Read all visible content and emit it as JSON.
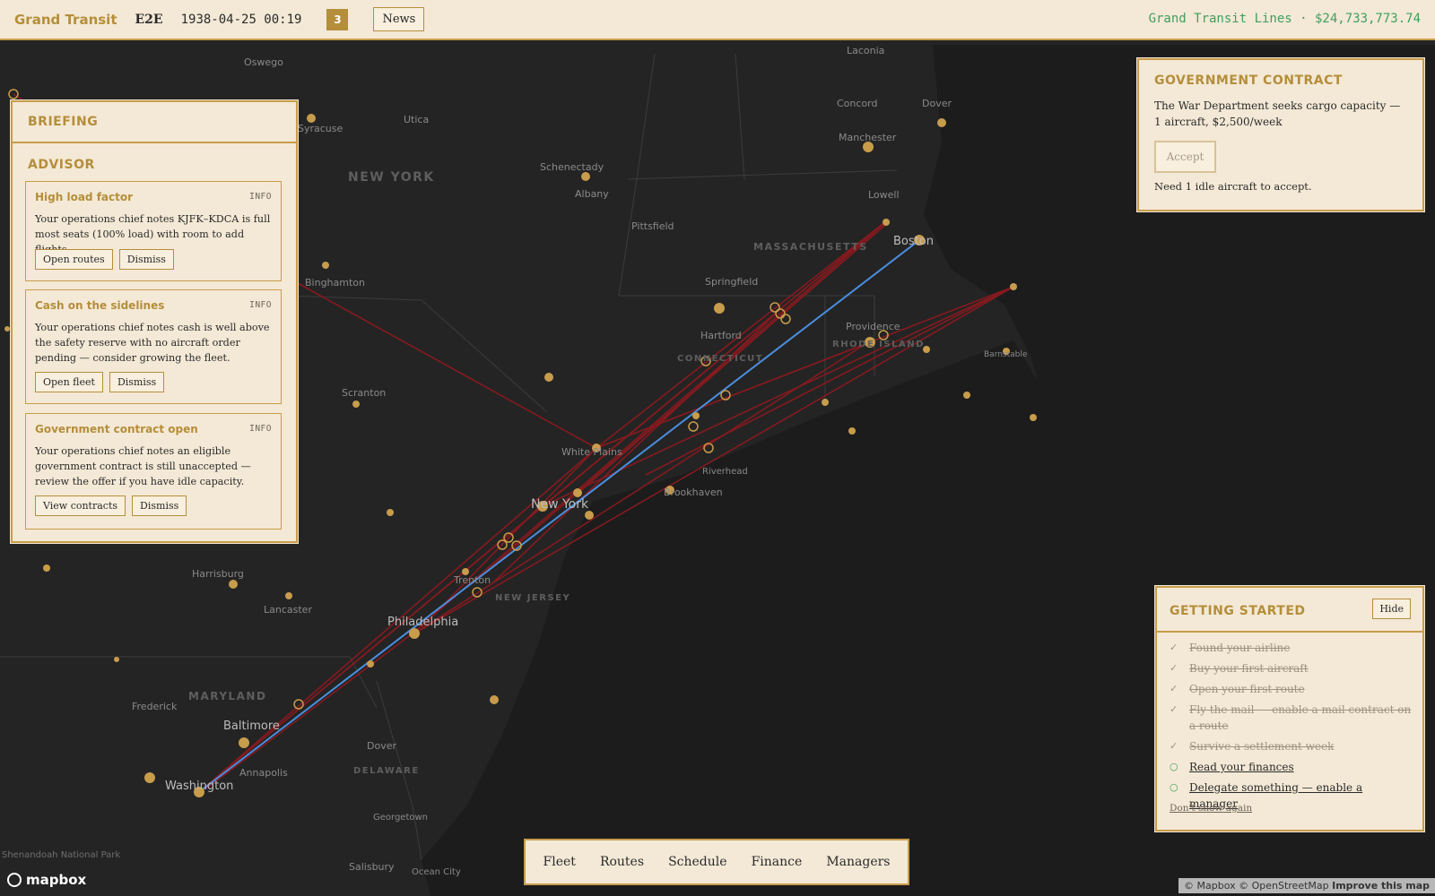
{
  "topbar": {
    "brand": "Grand Transit",
    "code": "E2E",
    "datetime": "1938-04-25 00:19",
    "notifications": "3",
    "news_label": "News",
    "company_cash": "Grand Transit Lines · $24,733,773.74"
  },
  "briefing": {
    "title": "BRIEFING",
    "advisor_title": "ADVISOR",
    "cards": [
      {
        "title": "High load factor",
        "tag": "INFO",
        "body": "Your operations chief notes KJFK–KDCA is full most seats (100% load) with room to add flights.",
        "primary": "Open routes",
        "dismiss": "Dismiss"
      },
      {
        "title": "Cash on the sidelines",
        "tag": "INFO",
        "body": "Your operations chief notes cash is well above the safety reserve with no aircraft order pending — consider growing the fleet.",
        "primary": "Open fleet",
        "dismiss": "Dismiss"
      },
      {
        "title": "Government contract open",
        "tag": "INFO",
        "body": "Your operations chief notes an eligible government contract is still unaccepted — review the offer if you have idle capacity.",
        "primary": "View contracts",
        "dismiss": "Dismiss"
      }
    ]
  },
  "government_contract": {
    "title": "GOVERNMENT CONTRACT",
    "body": "The War Department seeks cargo capacity — 1 aircraft, $2,500/week",
    "accept": "Accept",
    "note": "Need 1 idle aircraft to accept."
  },
  "getting_started": {
    "title": "GETTING STARTED",
    "hide": "Hide",
    "done_mark": "✓",
    "todo_mark": "○",
    "steps": [
      {
        "label": "Found your airline",
        "done": true
      },
      {
        "label": "Buy your first aircraft",
        "done": true
      },
      {
        "label": "Open your first route",
        "done": true
      },
      {
        "label": "Fly the mail — enable a mail contract on a route",
        "done": true
      },
      {
        "label": "Survive a settlement week",
        "done": true
      },
      {
        "label": "Read your finances",
        "done": false
      },
      {
        "label": "Delegate something — enable a manager",
        "done": false
      }
    ],
    "dont_show": "Don't show again"
  },
  "bottom_nav": [
    "Fleet",
    "Routes",
    "Schedule",
    "Finance",
    "Managers"
  ],
  "map": {
    "colors": {
      "route_red": "#8b1a1f",
      "route_blue": "#4a8fe0",
      "city_gold": "#c79c4b",
      "land": "#242424"
    },
    "city_labels": [
      "Oswego",
      "Laconia",
      "Concord",
      "Dover",
      "Manchester",
      "Lowell",
      "Boston",
      "Utica",
      "Syracuse",
      "Schenectady",
      "Albany",
      "Pittsfield",
      "Springfield",
      "Hartford",
      "Providence",
      "Barnstable",
      "Binghamton",
      "Scranton",
      "White Plains",
      "New York",
      "Riverhead",
      "Brookhaven",
      "Trenton",
      "Philadelphia",
      "Harrisburg",
      "Lancaster",
      "Frederick",
      "Baltimore",
      "Annapolis",
      "Washington",
      "Dover",
      "Georgetown",
      "Salisbury",
      "Ocean City",
      "Shenandoah National Park"
    ],
    "region_labels": [
      "NEW YORK",
      "MASSACHUSETTS",
      "CONNECTICUT",
      "RHODE ISLAND",
      "NEW JERSEY",
      "MARYLAND",
      "DELAWARE"
    ],
    "logo": "mapbox",
    "attribution_prefix": "© Mapbox © OpenStreetMap",
    "attribution_link": "Improve this map"
  }
}
